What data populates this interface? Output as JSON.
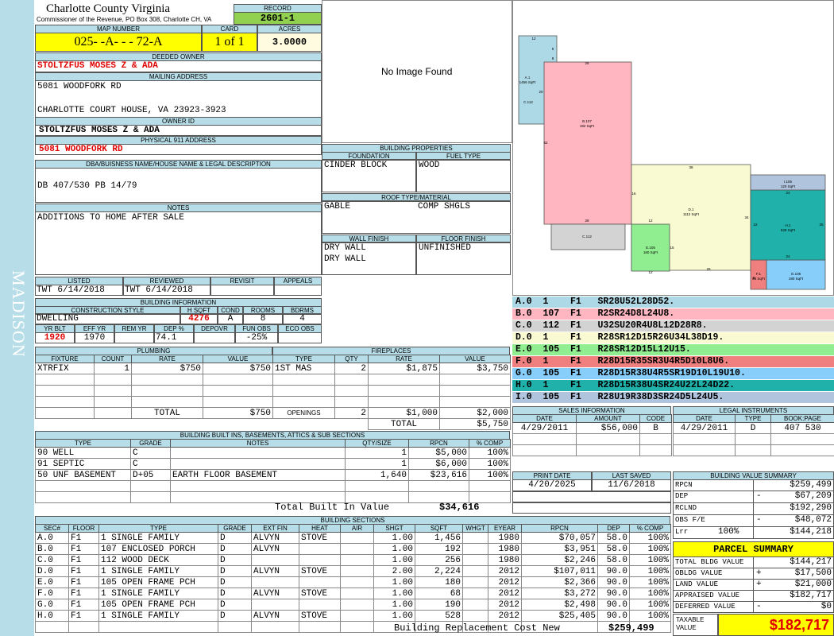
{
  "sidebar_text": "MADISON",
  "county_title": "Charlotte County Virginia",
  "commissioner": "Commissioner of the Revenue, PO Box 308, Charlotte CH, VA",
  "record": {
    "label": "RECORD",
    "value": "2601-1"
  },
  "map": {
    "map_label": "MAP NUMBER",
    "map_number": "025-  -A-  -  - 72-A",
    "card_label": "CARD",
    "card_value": "1 of 1",
    "acres_label": "ACRES",
    "acres_value": "3.0000"
  },
  "deeded_owner": {
    "label": "DEEDED OWNER",
    "value": "STOLTZFUS MOSES Z & ADA"
  },
  "mailing": {
    "label": "MAILING ADDRESS",
    "line1": "5081 WOODFORK RD",
    "line2": "CHARLOTTE COURT HOUSE, VA 23923-3923"
  },
  "owner_id": {
    "label": "OWNER ID",
    "value": "STOLTZFUS MOSES Z & ADA"
  },
  "physical": {
    "label": "PHYSICAL 911 ADDRESS",
    "value": "5081 WOODFORK RD"
  },
  "dba": {
    "label": "DBA/BUISNESS NAME/HOUSE NAME & LEGAL DESCRIPTION",
    "value": "DB 407/530 PB 14/79"
  },
  "notes": {
    "label": "NOTES",
    "value": "ADDITIONS TO HOME AFTER SALE"
  },
  "photo": {
    "text": "No Image Found"
  },
  "building_props": {
    "label": "BUILDING PROPERTIES",
    "foundation_label": "FOUNDATION",
    "foundation": "CINDER BLOCK",
    "fuel_label": "FUEL TYPE",
    "fuel": "WOOD",
    "roof_label": "ROOF TYPE/MATERIAL",
    "roof_type": "GABLE",
    "roof_material": "COMP SHGLS",
    "wall_label": "WALL FINISH",
    "wall1": "DRY WALL",
    "wall2": "DRY WALL",
    "floor_label": "FLOOR FINISH",
    "floor": "UNFINISHED"
  },
  "listed": {
    "listed_label": "LISTED",
    "listed_value": "TWT  6/14/2018",
    "reviewed_label": "REVIEWED",
    "reviewed_value": "TWT  6/14/2018",
    "revisit_label": "REVISIT",
    "appeals_label": "APPEALS"
  },
  "building_info": {
    "label": "BUILDING INFORMATION",
    "style_label": "CONSTRUCTION STYLE",
    "style": "DWELLING",
    "hsqft_label": "H SQFT",
    "hsqft": "4276",
    "cond_label": "COND",
    "cond": "A",
    "rooms_label": "ROOMS",
    "rooms": "8",
    "bdrms_label": "BDRMS",
    "bdrms": "4",
    "yrblt_label": "YR BLT",
    "yrblt": "1920",
    "effyr_label": "EFF YR",
    "effyr": "1970",
    "remyr_label": "REM YR",
    "remyr": "",
    "dep_label": "DEP %",
    "dep": "74.1",
    "depovr_label": "DEPOVR",
    "depovr": "",
    "funobs_label": "FUN OBS",
    "funobs": "-25%",
    "ecoobs_label": "ECO OBS",
    "ecoobs": ""
  },
  "plumbing": {
    "label": "PLUMBING",
    "headers": [
      "FIXTURE",
      "COUNT",
      "RATE",
      "VALUE"
    ],
    "rows": [
      [
        "XTRFIX",
        "1",
        "$750",
        "$750"
      ]
    ],
    "total_label": "TOTAL",
    "total": "$750"
  },
  "fireplaces": {
    "label": "FIREPLACES",
    "headers": [
      "TYPE",
      "QTY",
      "RATE",
      "VALUE"
    ],
    "rows": [
      [
        "1ST MAS",
        "2",
        "$1,875",
        "$3,750"
      ]
    ],
    "openings_label": "OPENINGS",
    "openings_qty": "2",
    "openings_rate": "$1,000",
    "openings_value": "$2,000",
    "total_label": "TOTAL",
    "total": "$5,750"
  },
  "built_ins": {
    "label": "BUILDING BUILT INS, BASEMENTS, ATTICS & SUB SECTIONS",
    "headers": [
      "TYPE",
      "GRADE",
      "NOTES",
      "QTY/SIZE",
      "RPCN",
      "% COMP"
    ],
    "rows": [
      [
        "90 WELL",
        "C",
        "",
        "1",
        "$5,000",
        "100%"
      ],
      [
        "91 SEPTIC",
        "C",
        "",
        "1",
        "$6,000",
        "100%"
      ],
      [
        "50 UNF BASEMENT",
        "D+05",
        "EARTH FLOOR BASEMENT",
        "1,640",
        "$23,616",
        "100%"
      ]
    ],
    "total_label": "Total Built In Value",
    "total": "$34,616"
  },
  "sections": {
    "label": "BUILDING SECTIONS",
    "headers": [
      "SEC#",
      "FLOOR",
      "TYPE",
      "GRADE",
      "EXT FIN",
      "HEAT",
      "AIR",
      "SHGT",
      "SQFT",
      "WHGT",
      "EYEAR",
      "RPCN",
      "DEP",
      "% COMP"
    ],
    "rows": [
      [
        "A.0",
        "F1",
        "1 SINGLE FAMILY",
        "D",
        "ALVYN",
        "STOVE",
        "",
        "1.00",
        "1,456",
        "",
        "1980",
        "$70,057",
        "58.0",
        "100%"
      ],
      [
        "B.0",
        "F1",
        "107 ENCLOSED PORCH",
        "D",
        "ALVYN",
        "",
        "",
        "1.00",
        "192",
        "",
        "1980",
        "$3,951",
        "58.0",
        "100%"
      ],
      [
        "C.0",
        "F1",
        "112 WOOD DECK",
        "D",
        "",
        "",
        "",
        "1.00",
        "256",
        "",
        "1980",
        "$2,246",
        "58.0",
        "100%"
      ],
      [
        "D.0",
        "F1",
        "1 SINGLE FAMILY",
        "D",
        "ALVYN",
        "STOVE",
        "",
        "2.00",
        "2,224",
        "",
        "2012",
        "$107,011",
        "90.0",
        "100%"
      ],
      [
        "E.0",
        "F1",
        "105 OPEN FRAME PCH",
        "D",
        "",
        "",
        "",
        "1.00",
        "180",
        "",
        "2012",
        "$2,366",
        "90.0",
        "100%"
      ],
      [
        "F.0",
        "F1",
        "1 SINGLE FAMILY",
        "D",
        "ALVYN",
        "STOVE",
        "",
        "1.00",
        "68",
        "",
        "2012",
        "$3,272",
        "90.0",
        "100%"
      ],
      [
        "G.0",
        "F1",
        "105 OPEN FRAME PCH",
        "D",
        "",
        "",
        "",
        "1.00",
        "190",
        "",
        "2012",
        "$2,498",
        "90.0",
        "100%"
      ],
      [
        "H.0",
        "F1",
        "1 SINGLE FAMILY",
        "D",
        "ALVYN",
        "STOVE",
        "",
        "1.00",
        "528",
        "",
        "2012",
        "$25,405",
        "90.0",
        "100%"
      ]
    ],
    "total_label": "Building Replacement Cost New",
    "total": "$259,499"
  },
  "sketch": {
    "areas": [
      {
        "id": "A.1",
        "area": "1456 SqFt",
        "color": "#add8e6"
      },
      {
        "id": "B.107",
        "area": "192 SqFt",
        "color": "#ffb6c1"
      },
      {
        "id": "C.112",
        "area": "",
        "color": "#d3d3d3"
      },
      {
        "id": "D.1",
        "area": "1112 SqFt",
        "color": "#fafad2"
      },
      {
        "id": "E.105",
        "area": "180 SqFt",
        "color": "#90ee90"
      },
      {
        "id": "F.1",
        "area": "68 SqFt",
        "color": "#f08080"
      },
      {
        "id": "G.105",
        "area": "190 SqFt",
        "color": "#87cefa"
      },
      {
        "id": "H.1",
        "area": "528 SqFt",
        "color": "#20b2aa"
      },
      {
        "id": "I.105",
        "area": "120 SqFt",
        "color": "#b0c4de"
      }
    ],
    "dims": [
      "12",
      "6",
      "8",
      "28",
      "20",
      "52",
      "28",
      "38",
      "16",
      "12",
      "34",
      "12",
      "15",
      "26",
      "24",
      "22",
      "24",
      "8",
      "25"
    ]
  },
  "codes": [
    {
      "text": "A.0  1    F1   SR28U52L28D52.",
      "color": "#add8e6"
    },
    {
      "text": "B.0  107  F1   R2SR24D8L24U8.",
      "color": "#ffb6c1"
    },
    {
      "text": "C.0  112  F1   U32SU20R4U8L12D28R8.",
      "color": "#d3d3d3"
    },
    {
      "text": "D.0  1    F1   R28SR12D15R26U34L38D19.",
      "color": "#fafad2"
    },
    {
      "text": "E.0  105  F1   R28SR12D15L12U15.",
      "color": "#90ee90"
    },
    {
      "text": "F.0  1    F1   R28D15R35SR3U4R5D10L8U6.",
      "color": "#f08080"
    },
    {
      "text": "G.0  105  F1   R28D15R38U4R5SR19D10L19U10.",
      "color": "#87cefa"
    },
    {
      "text": "H.0  1    F1   R28D15R38U4SR24U22L24D22.",
      "color": "#20b2aa"
    },
    {
      "text": "I.0  105  F1   R28U19R38D3SR24D5L24U5.",
      "color": "#b0c4de"
    }
  ],
  "sales": {
    "label": "SALES INFORMATION",
    "headers": [
      "DATE",
      "AMOUNT",
      "CODE"
    ],
    "rows": [
      [
        "4/29/2011",
        "$56,000",
        "B"
      ]
    ]
  },
  "legal": {
    "label": "LEGAL INSTRUMENTS",
    "headers": [
      "DATE",
      "TYPE",
      "BOOK:PAGE"
    ],
    "rows": [
      [
        "4/29/2011",
        "D",
        "407 530"
      ]
    ]
  },
  "print": {
    "print_label": "PRINT DATE",
    "print_date": "4/20/2025",
    "saved_label": "LAST SAVED",
    "saved_date": "11/6/2018"
  },
  "value_summary": {
    "label": "BUILDING VALUE SUMMARY",
    "rows": [
      {
        "label": "RPCN",
        "sign": "",
        "pct": "",
        "value": "$259,499"
      },
      {
        "label": "DEP",
        "sign": "-",
        "pct": "",
        "value": "$67,209"
      },
      {
        "label": "RCLND",
        "sign": "",
        "pct": "",
        "value": "$192,290"
      },
      {
        "label": "OBS F/E",
        "sign": "-",
        "pct": "",
        "value": "$48,072"
      },
      {
        "label": "Lrr",
        "sign": "",
        "pct": "100%",
        "value": "$144,218"
      }
    ]
  },
  "parcel_summary": {
    "label": "PARCEL SUMMARY",
    "rows": [
      {
        "label": "TOTAL BLDG VALUE",
        "sign": "",
        "value": "$144,217"
      },
      {
        "label": "OBLDG VALUE",
        "sign": "+",
        "value": "$17,500"
      },
      {
        "label": "LAND VALUE",
        "sign": "+",
        "value": "$21,000"
      },
      {
        "label": "APPRAISED VALUE",
        "sign": "",
        "value": "$182,717"
      },
      {
        "label": "DEFERRED VALUE",
        "sign": "-",
        "value": "$0"
      }
    ],
    "taxable_label": "TAXABLE VALUE",
    "taxable_value": "$182,717"
  }
}
